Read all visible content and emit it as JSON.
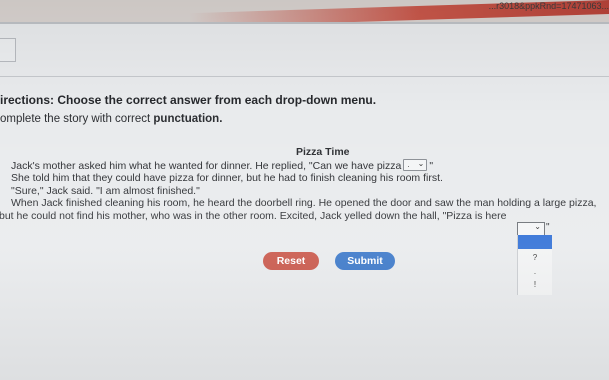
{
  "browser": {
    "url_fragment": "...r3018&ppkRnd=17471063..."
  },
  "colors": {
    "accent_reset": "#c9574a",
    "accent_submit": "#3b78c9",
    "dropdown_highlight": "#2f6fd6"
  },
  "page": {
    "directions": "irections: Choose the correct answer from each drop-down menu.",
    "instruction_prefix": "omplete the story with correct ",
    "instruction_bold": "punctuation."
  },
  "story": {
    "title": "Pizza Time",
    "line1_before": "Jack's mother asked him what he wanted for dinner. He replied, \"Can we have pizza",
    "line1_after": "\"",
    "line2": "She told him that they could have pizza for dinner, but he had to finish cleaning his room first.",
    "line3": "\"Sure,\" Jack said. \"I am almost finished.\"",
    "line4": "When Jack finished cleaning his room, he heard the doorbell ring. He opened the door and saw the man holding a large pizza,",
    "line5_before": "but he could not find his mother, who was in the other room. Excited, Jack yelled down the hall, \"Pizza is here",
    "line5_after": "\""
  },
  "dropdown1": {
    "selected": ".",
    "icon": "chevron-down-icon"
  },
  "dropdown2": {
    "selected": "",
    "icon": "chevron-down-icon",
    "options": [
      "",
      "?",
      ".",
      "!"
    ]
  },
  "buttons": {
    "reset": "Reset",
    "submit": "Submit"
  }
}
